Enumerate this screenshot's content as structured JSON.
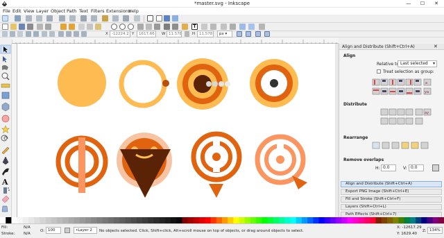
{
  "window": {
    "title": "*master.svg - Inkscape",
    "minimize": "—",
    "maximize": "☐",
    "close": "✕"
  },
  "menu": [
    "File",
    "Edit",
    "View",
    "Layer",
    "Object",
    "Path",
    "Text",
    "Filters",
    "Extensions",
    "Help"
  ],
  "controls": {
    "x_label": "X",
    "x_value": "-12224.2",
    "y_label": "Y",
    "y_value": "1617.66",
    "w_label": "W",
    "w_value": "11.578",
    "h_label": "H",
    "h_value": "11.578",
    "unit": "px"
  },
  "panel": {
    "title": "Align and Distribute (Shift+Ctrl+A)",
    "align_heading": "Align",
    "relative_to_label": "Relative to:",
    "relative_to_value": "Last selected",
    "treat_as_group_label": "Treat selection as group:",
    "distribute_heading": "Distribute",
    "rearrange_heading": "Rearrange",
    "remove_overlaps_heading": "Remove overlaps",
    "h_label": "H:",
    "h_value": "0.0",
    "v_label": "V:",
    "v_value": "0.0",
    "docked": [
      "Align and Distribute (Shift+Ctrl+A)",
      "Export PNG Image (Shift+Ctrl+E)",
      "Fill and Stroke (Shift+Ctrl+F)",
      "Layers (Shift+Ctrl+L)",
      "Path Effects  (Shift+Ctrl+7)"
    ]
  },
  "status": {
    "fill_label": "Fill:",
    "fill_value": "N/A",
    "stroke_label": "Stroke:",
    "stroke_value": "N/A",
    "opacity_label": "O:",
    "opacity_value": "100",
    "layer_value": "•Layer 2",
    "message": "No objects selected. Click, Shift+click, Alt+scroll mouse on top of objects, or drag around objects to select.",
    "x_coord": "X: -12617.29",
    "y_coord": "Y:    1629.40",
    "zoom_label": "Z:",
    "zoom_value": "134%"
  },
  "colors": {
    "light_orange": "#fdbb52",
    "orange": "#e0640f",
    "dark_brown": "#5a2306",
    "peach": "#f7c4a3",
    "salmon": "#fc955f",
    "gray_dot": "#bdbdbd",
    "charcoal": "#333333"
  }
}
